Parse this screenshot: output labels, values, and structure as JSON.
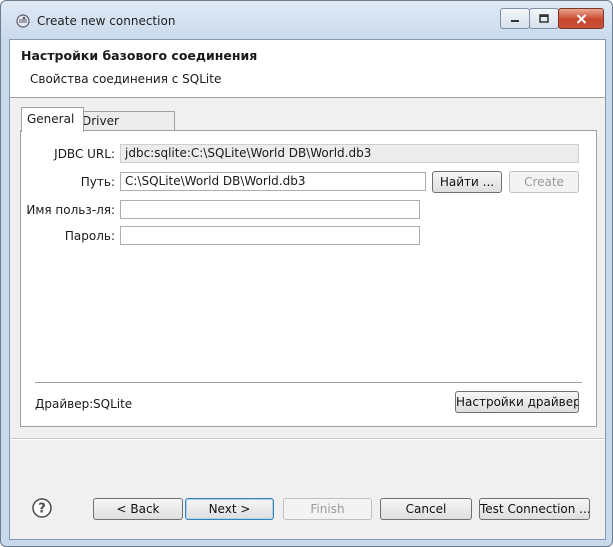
{
  "window": {
    "title": "Create new connection",
    "controls": {
      "minimize": "minimize-icon",
      "maximize": "maximize-icon",
      "close": "close-icon"
    }
  },
  "banner": {
    "title": "Настройки базового соединения",
    "subtitle": "Свойства соединения с SQLite"
  },
  "tabs": [
    {
      "label": "General",
      "active": true
    },
    {
      "label": "Driver properties",
      "active": false
    }
  ],
  "form": {
    "jdbc_url": {
      "label": "JDBC URL:",
      "value": "jdbc:sqlite:C:\\SQLite\\World DB\\World.db3"
    },
    "path": {
      "label": "Путь:",
      "value": "C:\\SQLite\\World DB\\World.db3"
    },
    "browse_label": "Найти ...",
    "create_label": "Create",
    "username": {
      "label": "Имя польз-ля:",
      "value": ""
    },
    "password": {
      "label": "Пароль:",
      "value": ""
    }
  },
  "driver": {
    "label": "Драйвер:",
    "name": "SQLite",
    "settings_label": "Настройки драйвера"
  },
  "footer": {
    "back": "< Back",
    "next": "Next >",
    "finish": "Finish",
    "cancel": "Cancel",
    "test": "Test Connection ..."
  },
  "colors": {
    "accent": "#3c7fb1",
    "title_gradient": "#c9d9ec",
    "close": "#c7462b"
  }
}
